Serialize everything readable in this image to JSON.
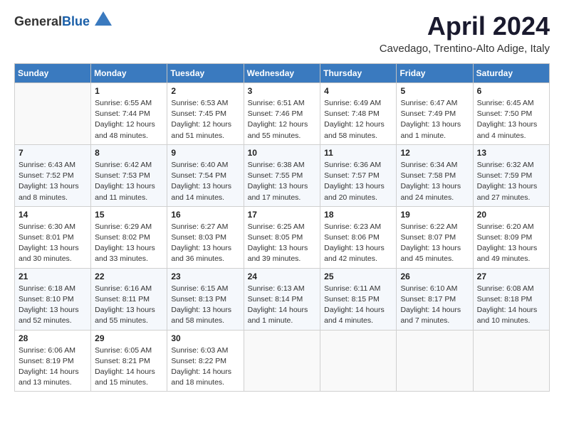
{
  "header": {
    "logo_general": "General",
    "logo_blue": "Blue",
    "month_title": "April 2024",
    "subtitle": "Cavedago, Trentino-Alto Adige, Italy"
  },
  "weekdays": [
    "Sunday",
    "Monday",
    "Tuesday",
    "Wednesday",
    "Thursday",
    "Friday",
    "Saturday"
  ],
  "weeks": [
    [
      {
        "day": "",
        "info": ""
      },
      {
        "day": "1",
        "info": "Sunrise: 6:55 AM\nSunset: 7:44 PM\nDaylight: 12 hours\nand 48 minutes."
      },
      {
        "day": "2",
        "info": "Sunrise: 6:53 AM\nSunset: 7:45 PM\nDaylight: 12 hours\nand 51 minutes."
      },
      {
        "day": "3",
        "info": "Sunrise: 6:51 AM\nSunset: 7:46 PM\nDaylight: 12 hours\nand 55 minutes."
      },
      {
        "day": "4",
        "info": "Sunrise: 6:49 AM\nSunset: 7:48 PM\nDaylight: 12 hours\nand 58 minutes."
      },
      {
        "day": "5",
        "info": "Sunrise: 6:47 AM\nSunset: 7:49 PM\nDaylight: 13 hours\nand 1 minute."
      },
      {
        "day": "6",
        "info": "Sunrise: 6:45 AM\nSunset: 7:50 PM\nDaylight: 13 hours\nand 4 minutes."
      }
    ],
    [
      {
        "day": "7",
        "info": "Sunrise: 6:43 AM\nSunset: 7:52 PM\nDaylight: 13 hours\nand 8 minutes."
      },
      {
        "day": "8",
        "info": "Sunrise: 6:42 AM\nSunset: 7:53 PM\nDaylight: 13 hours\nand 11 minutes."
      },
      {
        "day": "9",
        "info": "Sunrise: 6:40 AM\nSunset: 7:54 PM\nDaylight: 13 hours\nand 14 minutes."
      },
      {
        "day": "10",
        "info": "Sunrise: 6:38 AM\nSunset: 7:55 PM\nDaylight: 13 hours\nand 17 minutes."
      },
      {
        "day": "11",
        "info": "Sunrise: 6:36 AM\nSunset: 7:57 PM\nDaylight: 13 hours\nand 20 minutes."
      },
      {
        "day": "12",
        "info": "Sunrise: 6:34 AM\nSunset: 7:58 PM\nDaylight: 13 hours\nand 24 minutes."
      },
      {
        "day": "13",
        "info": "Sunrise: 6:32 AM\nSunset: 7:59 PM\nDaylight: 13 hours\nand 27 minutes."
      }
    ],
    [
      {
        "day": "14",
        "info": "Sunrise: 6:30 AM\nSunset: 8:01 PM\nDaylight: 13 hours\nand 30 minutes."
      },
      {
        "day": "15",
        "info": "Sunrise: 6:29 AM\nSunset: 8:02 PM\nDaylight: 13 hours\nand 33 minutes."
      },
      {
        "day": "16",
        "info": "Sunrise: 6:27 AM\nSunset: 8:03 PM\nDaylight: 13 hours\nand 36 minutes."
      },
      {
        "day": "17",
        "info": "Sunrise: 6:25 AM\nSunset: 8:05 PM\nDaylight: 13 hours\nand 39 minutes."
      },
      {
        "day": "18",
        "info": "Sunrise: 6:23 AM\nSunset: 8:06 PM\nDaylight: 13 hours\nand 42 minutes."
      },
      {
        "day": "19",
        "info": "Sunrise: 6:22 AM\nSunset: 8:07 PM\nDaylight: 13 hours\nand 45 minutes."
      },
      {
        "day": "20",
        "info": "Sunrise: 6:20 AM\nSunset: 8:09 PM\nDaylight: 13 hours\nand 49 minutes."
      }
    ],
    [
      {
        "day": "21",
        "info": "Sunrise: 6:18 AM\nSunset: 8:10 PM\nDaylight: 13 hours\nand 52 minutes."
      },
      {
        "day": "22",
        "info": "Sunrise: 6:16 AM\nSunset: 8:11 PM\nDaylight: 13 hours\nand 55 minutes."
      },
      {
        "day": "23",
        "info": "Sunrise: 6:15 AM\nSunset: 8:13 PM\nDaylight: 13 hours\nand 58 minutes."
      },
      {
        "day": "24",
        "info": "Sunrise: 6:13 AM\nSunset: 8:14 PM\nDaylight: 14 hours\nand 1 minute."
      },
      {
        "day": "25",
        "info": "Sunrise: 6:11 AM\nSunset: 8:15 PM\nDaylight: 14 hours\nand 4 minutes."
      },
      {
        "day": "26",
        "info": "Sunrise: 6:10 AM\nSunset: 8:17 PM\nDaylight: 14 hours\nand 7 minutes."
      },
      {
        "day": "27",
        "info": "Sunrise: 6:08 AM\nSunset: 8:18 PM\nDaylight: 14 hours\nand 10 minutes."
      }
    ],
    [
      {
        "day": "28",
        "info": "Sunrise: 6:06 AM\nSunset: 8:19 PM\nDaylight: 14 hours\nand 13 minutes."
      },
      {
        "day": "29",
        "info": "Sunrise: 6:05 AM\nSunset: 8:21 PM\nDaylight: 14 hours\nand 15 minutes."
      },
      {
        "day": "30",
        "info": "Sunrise: 6:03 AM\nSunset: 8:22 PM\nDaylight: 14 hours\nand 18 minutes."
      },
      {
        "day": "",
        "info": ""
      },
      {
        "day": "",
        "info": ""
      },
      {
        "day": "",
        "info": ""
      },
      {
        "day": "",
        "info": ""
      }
    ]
  ]
}
